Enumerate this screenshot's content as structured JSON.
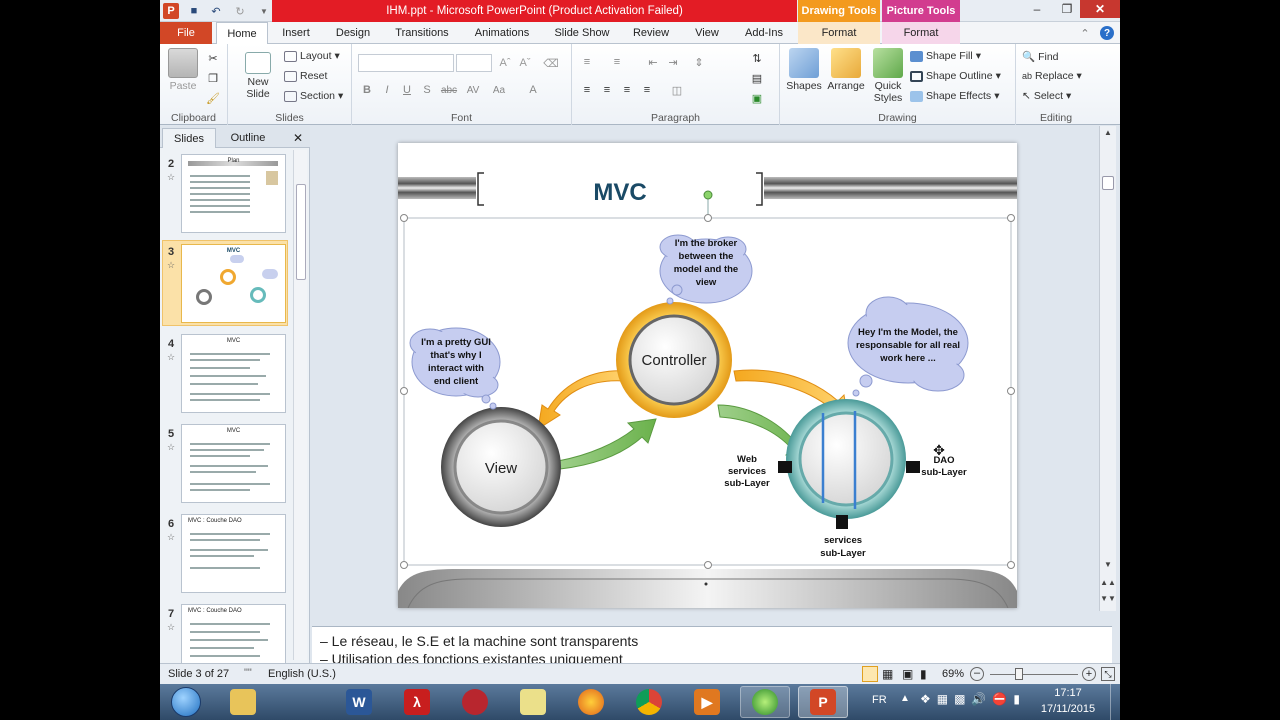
{
  "window": {
    "title": "IHM.ppt  -  Microsoft PowerPoint (Product Activation Failed)",
    "context_headers": [
      "Drawing Tools",
      "Picture Tools"
    ]
  },
  "tabs": [
    "File",
    "Home",
    "Insert",
    "Design",
    "Transitions",
    "Animations",
    "Slide Show",
    "Review",
    "View",
    "Add-Ins",
    "Format",
    "Format"
  ],
  "ribbon": {
    "clipboard": {
      "paste": "Paste",
      "label": "Clipboard"
    },
    "slides": {
      "new_slide": "New Slide",
      "layout": "Layout",
      "reset": "Reset",
      "section": "Section",
      "label": "Slides"
    },
    "font": {
      "label": "Font"
    },
    "paragraph": {
      "label": "Paragraph"
    },
    "drawing": {
      "shapes": "Shapes",
      "arrange": "Arrange",
      "quick_styles": "Quick Styles",
      "shape_fill": "Shape Fill",
      "shape_outline": "Shape Outline",
      "shape_effects": "Shape Effects",
      "label": "Drawing"
    },
    "editing": {
      "find": "Find",
      "replace": "Replace",
      "select": "Select",
      "label": "Editing"
    }
  },
  "pane": {
    "tab_slides": "Slides",
    "tab_outline": "Outline",
    "thumbnails": [
      {
        "number": "2",
        "title": "Plan"
      },
      {
        "number": "3",
        "title": "MVC"
      },
      {
        "number": "4",
        "title": "MVC"
      },
      {
        "number": "5",
        "title": "MVC"
      },
      {
        "number": "6",
        "title": "MVC : Couche DAO"
      },
      {
        "number": "7",
        "title": "MVC : Couche DAO"
      }
    ]
  },
  "slide": {
    "title": "MVC",
    "controller": "Controller",
    "view": "View",
    "bubble_controller": [
      "I'm the broker",
      "between the",
      "model and the",
      "view"
    ],
    "bubble_view": [
      "I'm a pretty GUI",
      "that's why I",
      "interact with",
      "end client"
    ],
    "bubble_model": [
      "Hey I'm the Model, the",
      "responsable for all real",
      "work here ..."
    ],
    "label_web": [
      "Web",
      "services",
      "sub-Layer"
    ],
    "label_dao": [
      "DAO",
      "sub-Layer"
    ],
    "label_services": [
      "services",
      "sub-Layer"
    ]
  },
  "notes": {
    "line1": "– Le réseau, le S.E et la machine sont transparents",
    "line2": "– Utilisation des fonctions existantes uniquement"
  },
  "status": {
    "slide_info": "Slide 3 of 27",
    "language": "English (U.S.)",
    "zoom": "69%",
    "zoom_level": 0.69
  },
  "taskbar": {
    "lang": "FR",
    "time": "17:17",
    "date": "17/11/2015"
  },
  "colors": {
    "file_tab": "#d24726",
    "title_red": "#e31c25",
    "drawing_tools": "#f39a1e",
    "picture_tools": "#d23c8f",
    "slide_title": "#1a4a66"
  }
}
